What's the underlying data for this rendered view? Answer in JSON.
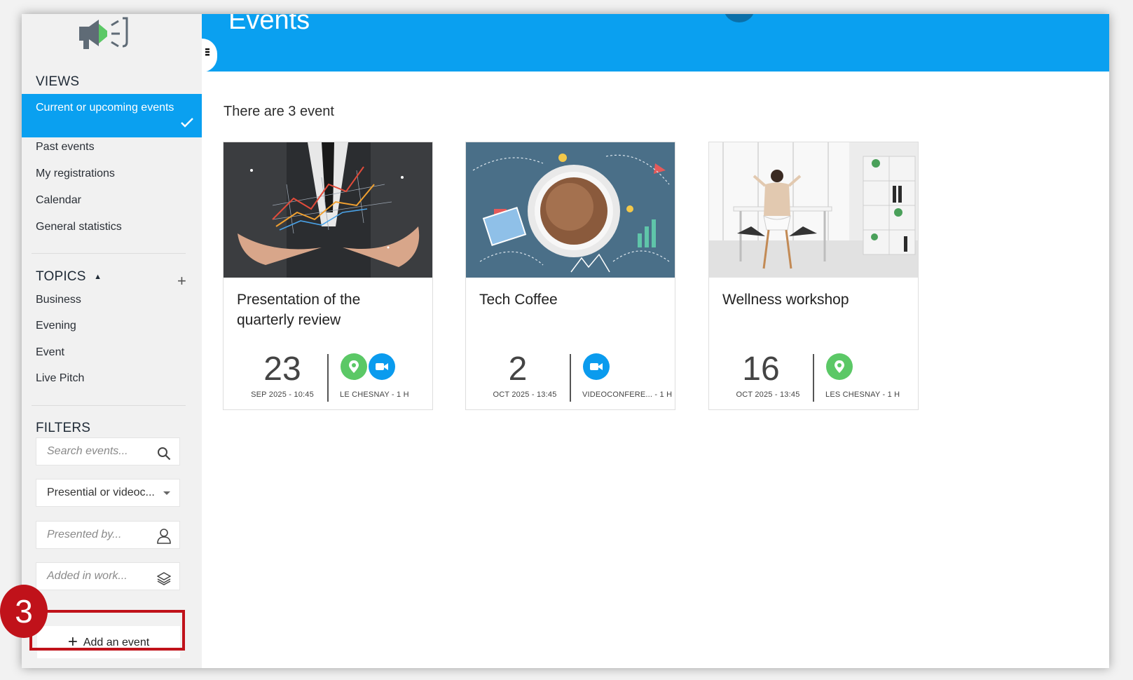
{
  "header": {
    "title": "Events"
  },
  "sidebar": {
    "views_title": "VIEWS",
    "views": [
      {
        "label": "Current or upcoming events",
        "active": true
      },
      {
        "label": "Past events"
      },
      {
        "label": "My registrations"
      },
      {
        "label": "Calendar"
      },
      {
        "label": "General statistics"
      }
    ],
    "topics_title": "TOPICS",
    "topics": [
      "Business",
      "Evening",
      "Event",
      "Live Pitch"
    ],
    "filters_title": "FILTERS",
    "filters": {
      "search_placeholder": "Search events...",
      "mode_value": "Presential or videoc...",
      "presenter_placeholder": "Presented by...",
      "workspace_placeholder": "Added in work..."
    },
    "add_event_label": "Add an event"
  },
  "main": {
    "count_text": "There are 3 event",
    "events": [
      {
        "title": "Presentation of the quarterly review",
        "day": "23",
        "date_sub": "SEP 2025 - 10:45",
        "location": "LE CHESNAY - 1 H",
        "badges": [
          "location-pin-icon",
          "video-camera-icon"
        ]
      },
      {
        "title": "Tech Coffee",
        "day": "2",
        "date_sub": "OCT 2025 - 13:45",
        "location": "VIDEOCONFERE...  - 1 H",
        "badges": [
          "video-camera-icon"
        ]
      },
      {
        "title": "Wellness workshop",
        "day": "16",
        "date_sub": "OCT 2025 - 13:45",
        "location": "LES CHESNAY - 1 H",
        "badges": [
          "location-pin-icon"
        ]
      }
    ]
  },
  "annotation": {
    "step_number": "3"
  },
  "colors": {
    "accent": "#0aa0f0",
    "green": "#5bc866",
    "highlight": "#c0121a"
  }
}
